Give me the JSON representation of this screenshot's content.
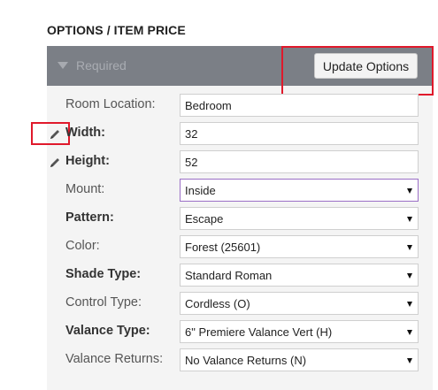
{
  "section": {
    "title": "OPTIONS / ITEM PRICE"
  },
  "panel": {
    "header_label": "Required",
    "update_button": "Update Options"
  },
  "fields": [
    {
      "label": "Room Location:",
      "value": "Bedroom",
      "kind": "text",
      "bold": false,
      "pencil": false
    },
    {
      "label": "Width:",
      "value": "32",
      "kind": "text",
      "bold": true,
      "pencil": true
    },
    {
      "label": "Height:",
      "value": "52",
      "kind": "text",
      "bold": true,
      "pencil": true
    },
    {
      "label": "Mount:",
      "value": "Inside",
      "kind": "select",
      "bold": false,
      "pencil": false
    },
    {
      "label": "Pattern:",
      "value": "Escape",
      "kind": "select",
      "bold": true,
      "pencil": false
    },
    {
      "label": "Color:",
      "value": "Forest (25601)",
      "kind": "select",
      "bold": false,
      "pencil": false
    },
    {
      "label": "Shade Type:",
      "value": "Standard Roman",
      "kind": "select",
      "bold": true,
      "pencil": false
    },
    {
      "label": "Control Type:",
      "value": "Cordless (O)",
      "kind": "select",
      "bold": false,
      "pencil": false
    },
    {
      "label": "Valance Type:",
      "value": "6\" Premiere Valance Vert (H)",
      "kind": "select",
      "bold": true,
      "pencil": false
    },
    {
      "label": "Valance Returns:",
      "value": "No Valance Returns (N)",
      "kind": "select",
      "bold": false,
      "pencil": false
    }
  ],
  "icons": {
    "pencil": "pencil-icon",
    "caret": "caret-down-icon",
    "select_arrow": "chevron-down-icon"
  },
  "colors": {
    "header_bg": "#7b7f86",
    "panel_bg": "#f4f4f4",
    "highlight": "#e0192b",
    "active_border": "#9b6fc6"
  }
}
